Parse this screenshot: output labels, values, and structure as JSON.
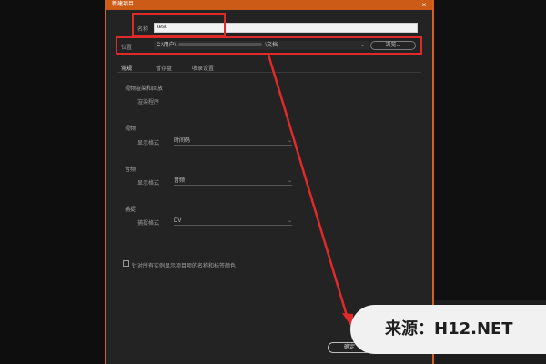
{
  "dialog": {
    "title": "新建项目",
    "close_icon": "close-icon",
    "name_label": "名称",
    "name_value": "test",
    "location_label": "位置",
    "location_prefix": "C:\\用户\\",
    "location_suffix": "\\文档",
    "browse_label": "浏览...",
    "tabs": [
      "常规",
      "暂存盘",
      "收录设置"
    ],
    "video_render": {
      "section": "视频渲染和回放",
      "renderer_label": "渲染程序"
    },
    "video": {
      "section": "视频",
      "format_label": "显示格式",
      "format_value": "时间码"
    },
    "audio": {
      "section": "音频",
      "format_label": "显示格式",
      "format_value": "音频"
    },
    "capture": {
      "section": "捕捉",
      "format_label": "捕捉格式",
      "format_value": "DV"
    },
    "checkbox_label": "针对所有实例显示项目项的名称和标签颜色",
    "ok_label": "确定"
  },
  "watermark": {
    "text": "来源：H12.NET"
  },
  "colors": {
    "titlebar": "#cc5b17",
    "annotation": "#e02a2a",
    "dialog_bg": "#232323"
  }
}
